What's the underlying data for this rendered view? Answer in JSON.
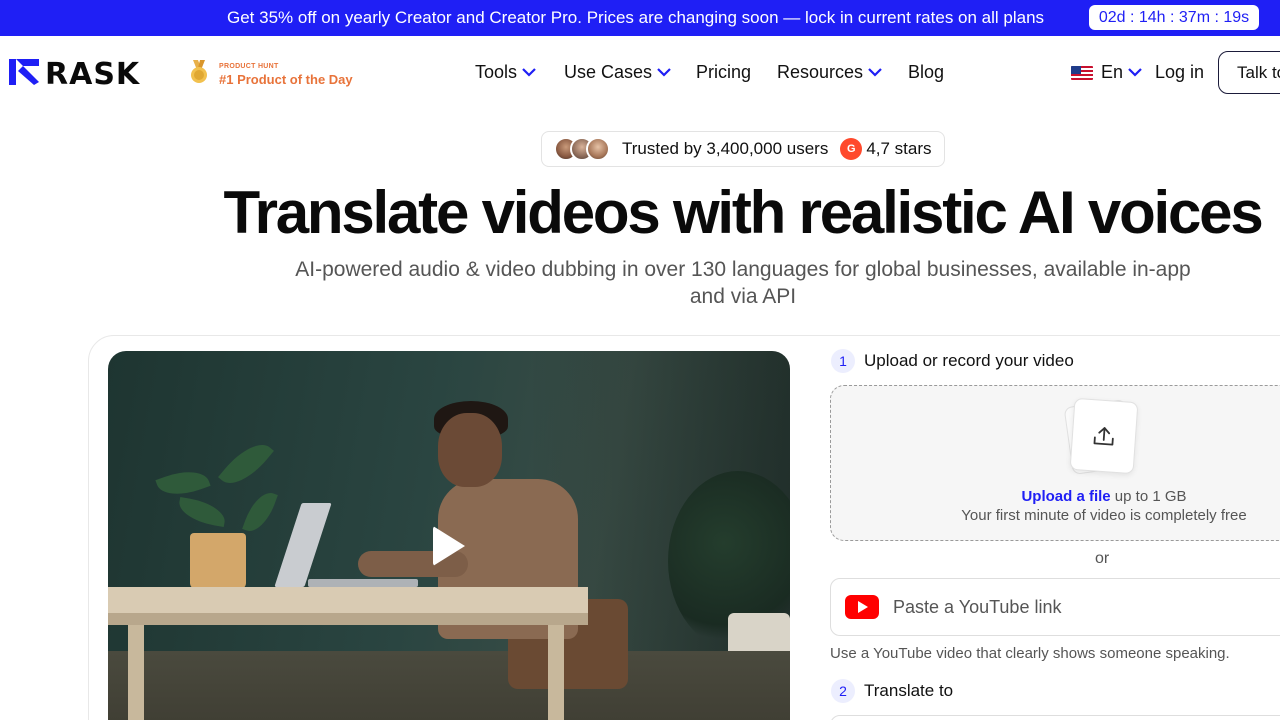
{
  "promo": {
    "text": "Get 35% off on yearly Creator and Creator Pro. Prices are changing soon — lock in current rates on all plans",
    "timer": "02d : 14h : 37m : 19s"
  },
  "header": {
    "logo_text": "RASK",
    "product_hunt_small": "PRODUCT HUNT",
    "product_hunt_big": "#1 Product of the Day",
    "nav": [
      {
        "label": "Tools",
        "has_dropdown": true
      },
      {
        "label": "Use Cases",
        "has_dropdown": true
      },
      {
        "label": "Pricing",
        "has_dropdown": false
      },
      {
        "label": "Resources",
        "has_dropdown": true
      },
      {
        "label": "Blog",
        "has_dropdown": false
      }
    ],
    "language": "En",
    "login": "Log in",
    "talk_button": "Talk to"
  },
  "hero": {
    "trust_users": "Trusted by 3,400,000 users",
    "trust_g2": "G",
    "trust_stars": "4,7 stars",
    "title": "Translate videos with realistic AI voices",
    "subtitle": "AI-powered audio & video dubbing in over 130 languages for global businesses, available in-app and via API"
  },
  "panel": {
    "step1_number": "1",
    "step1_label": "Upload or record your video",
    "upload_link": "Upload a file",
    "upload_limit": " up to 1 GB",
    "upload_note": "Your first minute of video is completely free",
    "or": "or",
    "youtube_placeholder": "Paste a YouTube link",
    "youtube_hint": "Use a YouTube video that clearly shows someone speaking.",
    "step2_number": "2",
    "step2_label": "Translate to"
  },
  "colors": {
    "brand_blue": "#1f1ff5",
    "product_hunt_orange": "#e8733a",
    "youtube_red": "#ff0000",
    "g2_red": "#ff492c"
  },
  "icons": [
    "rask-logo-icon",
    "medal-icon",
    "chevron-down-icon",
    "us-flag-icon",
    "g2-icon",
    "play-icon",
    "upload-icon",
    "youtube-icon"
  ]
}
